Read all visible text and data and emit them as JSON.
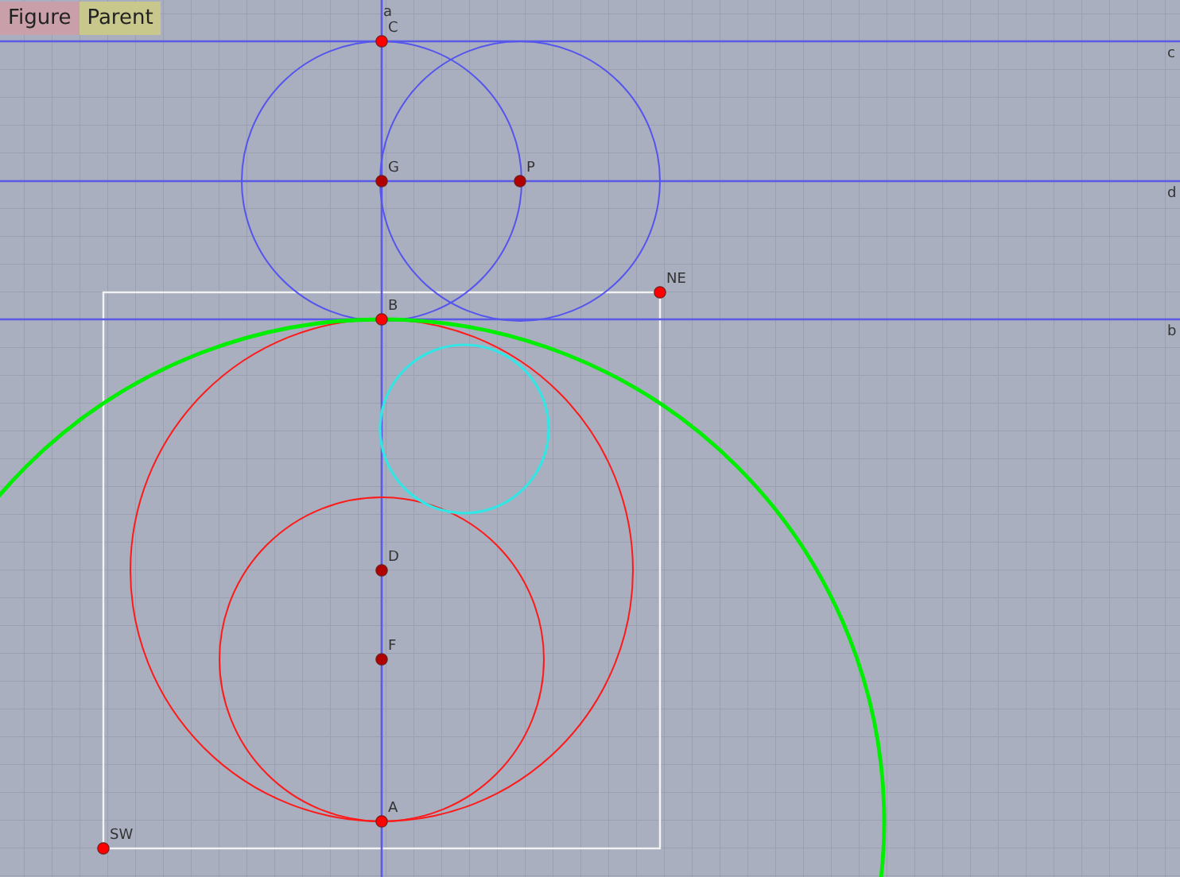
{
  "toolbar": {
    "buttons": [
      {
        "label": "Figure"
      },
      {
        "label": "Parent"
      }
    ]
  },
  "lines": [
    {
      "label": "a"
    },
    {
      "label": "c"
    },
    {
      "label": "d"
    },
    {
      "label": "b"
    }
  ],
  "circles": [
    {
      "color": "#5555ee"
    },
    {
      "color": "#5555ee"
    },
    {
      "color": "#ff1a1a"
    },
    {
      "color": "#ff1a1a"
    },
    {
      "color": "#33e6e6"
    },
    {
      "color": "#00ee00"
    }
  ],
  "points": [
    {
      "label": "C",
      "kind": "free"
    },
    {
      "label": "G",
      "kind": "dependent"
    },
    {
      "label": "P",
      "kind": "dependent"
    },
    {
      "label": "B",
      "kind": "free"
    },
    {
      "label": "NE",
      "kind": "free"
    },
    {
      "label": "D",
      "kind": "dependent"
    },
    {
      "label": "F",
      "kind": "dependent"
    },
    {
      "label": "A",
      "kind": "free"
    },
    {
      "label": "SW",
      "kind": "free"
    }
  ]
}
